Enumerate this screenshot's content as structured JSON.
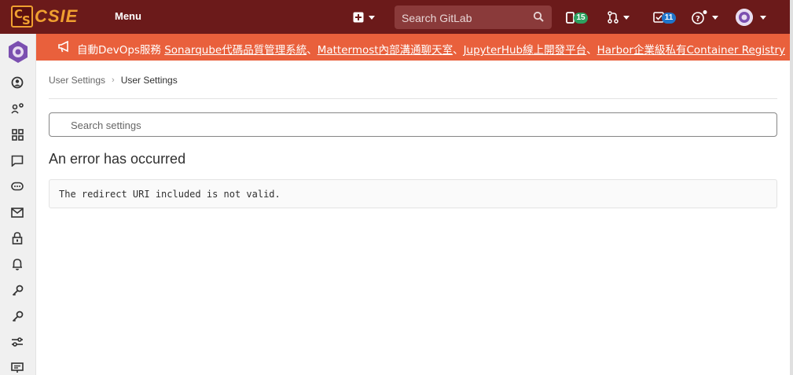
{
  "navbar": {
    "logo_text": "CSIE",
    "logo_letters": [
      "C",
      "S"
    ],
    "menu_label": "Menu",
    "search_placeholder": "Search GitLab",
    "issues_count": "15",
    "todos_count": "11",
    "colors": {
      "bg": "#6b1a1a",
      "logo": "#f0a030",
      "search_bg": "#8a3a3a"
    }
  },
  "banner": {
    "prefix": "自動DevOps服務 ",
    "links": [
      "Sonarqube代碼品質管理系統",
      "Mattermost內部溝通聊天室",
      "JupyterHub線上開發平台",
      "Harbor企業級私有Container Registry"
    ],
    "separator": "、",
    "color": "#e9603c"
  },
  "sidebar": {
    "items": [
      {
        "icon": "profile-icon"
      },
      {
        "icon": "account-icon"
      },
      {
        "icon": "applications-icon"
      },
      {
        "icon": "chat-icon"
      },
      {
        "icon": "access-tokens-icon"
      },
      {
        "icon": "emails-icon"
      },
      {
        "icon": "password-icon"
      },
      {
        "icon": "notifications-icon"
      },
      {
        "icon": "ssh-keys-icon"
      },
      {
        "icon": "gpg-keys-icon"
      },
      {
        "icon": "preferences-icon"
      },
      {
        "icon": "active-sessions-icon"
      }
    ]
  },
  "breadcrumb": {
    "parent": "User Settings",
    "current": "User Settings"
  },
  "settings_search": {
    "placeholder": "Search settings"
  },
  "error": {
    "title": "An error has occurred",
    "message": "The redirect URI included is not valid."
  }
}
